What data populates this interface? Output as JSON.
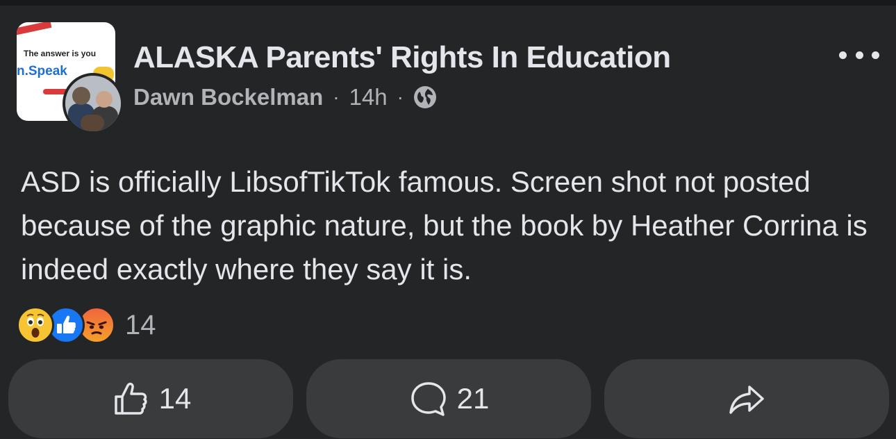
{
  "post": {
    "group_name": "ALASKA Parents' Rights In Education",
    "author": "Dawn Bockelman",
    "time": "14h",
    "separator": "·",
    "group_avatar": {
      "line1": "The answer is you",
      "line2": "n.Speak"
    },
    "text": "ASD is officially LibsofTikTok famous. Screen shot not posted because of the graphic nature, but the book by Heather Corrina is indeed exactly where they say it is.",
    "reactions": {
      "icons": [
        "wow-icon",
        "like-icon",
        "angry-icon"
      ],
      "count": "14"
    }
  },
  "actions": {
    "like_count": "14",
    "comment_count": "21",
    "share_icon": "share-arrow-icon"
  },
  "colors": {
    "background": "#242526",
    "text": "#e4e6eb",
    "secondary_text": "#b0b3b8",
    "button_bg": "#3a3b3c",
    "like_blue": "#1877f2"
  }
}
